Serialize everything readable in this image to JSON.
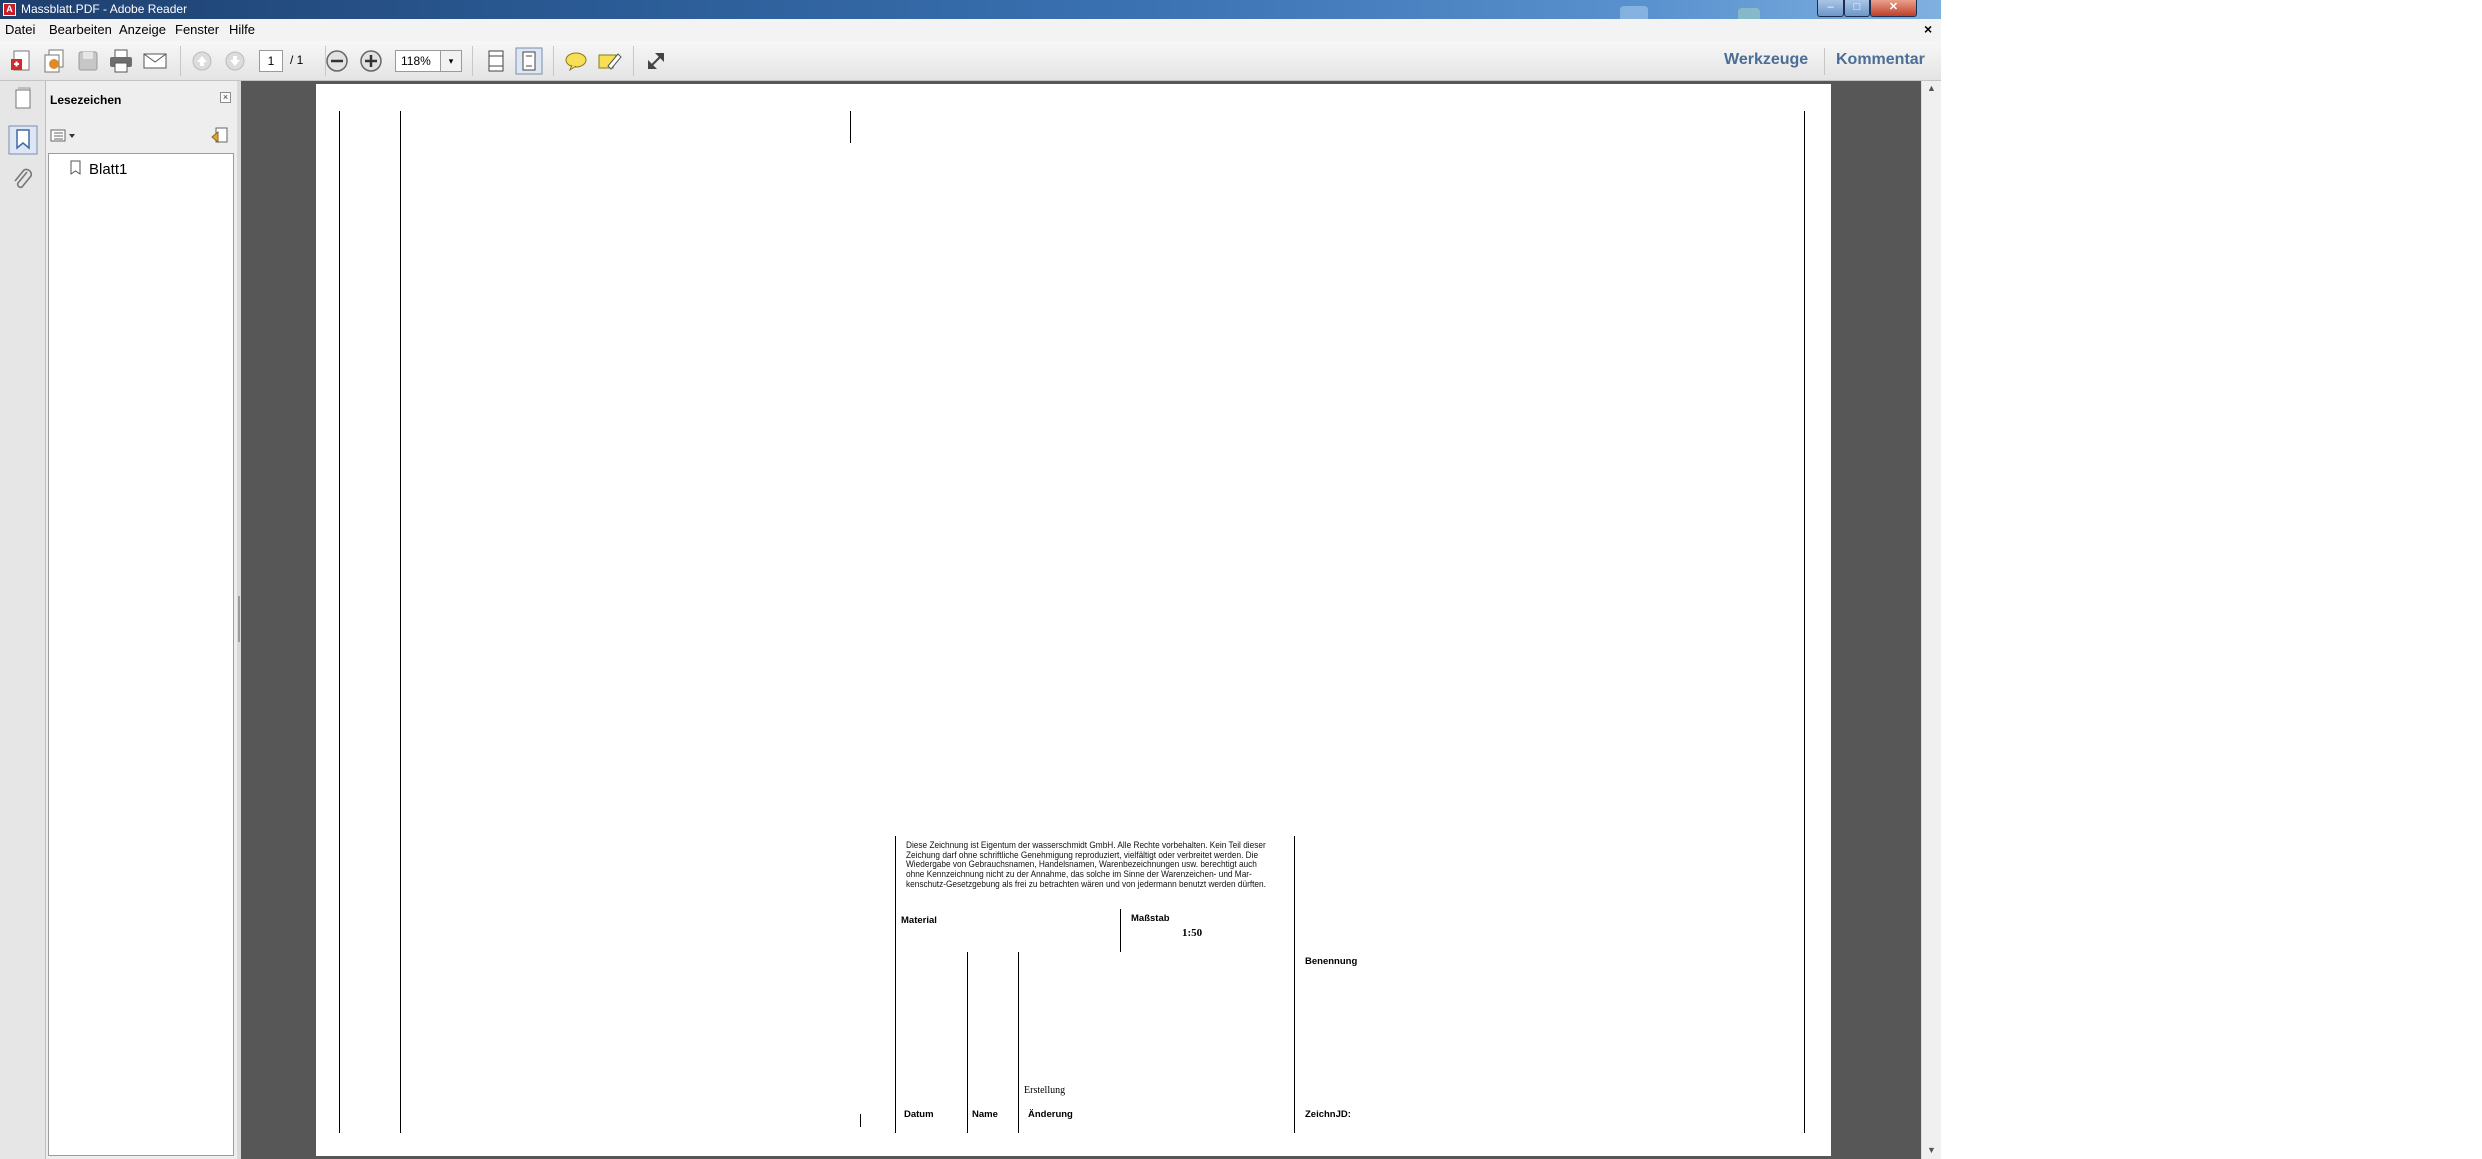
{
  "window": {
    "title": "Massblatt.PDF - Adobe Reader",
    "controls": {
      "minimize": "–",
      "maximize": "□",
      "close": "✕"
    }
  },
  "menubar": {
    "items": [
      "Datei",
      "Bearbeiten",
      "Anzeige",
      "Fenster",
      "Hilfe"
    ],
    "close_glyph": "×"
  },
  "toolbar": {
    "current_page": "1",
    "page_total": "/ 1",
    "zoom": "118%",
    "zoom_dropdown_glyph": "▾",
    "werkzeuge_label": "Werkzeuge",
    "kommentar_label": "Kommentar",
    "icons": [
      "create-pdf-icon",
      "combine-icon",
      "save-icon",
      "print-icon",
      "email-icon",
      "previous-page-icon",
      "next-page-icon",
      "zoom-out-icon",
      "zoom-in-icon",
      "fit-width-icon",
      "fit-page-icon",
      "comment-icon",
      "highlight-icon",
      "expand-icon"
    ]
  },
  "sidebar": {
    "panel_title": "Lesezeichen",
    "close_glyph": "×",
    "bookmarks": [
      {
        "label": "Blatt1"
      }
    ]
  },
  "document": {
    "copyright_lines": [
      "Diese Zeichnung ist Eigentum der wasserschmidt GmbH. Alle Rechte vorbehalten. Kein Teil dieser",
      "Zeichung darf ohne schriftliche  Genehmigung reproduziert, vielfältigt oder verbreitet werden. Die",
      "Wiedergabe von Gebrauchsnamen, Handelsnamen, Warenbezeichnungen usw. berechtigt auch",
      "ohne Kennzeichnung nicht zu der Annahme, das solche im Sinne der  Warenzeichen- und Mar-",
      "kenschutz-Gesetzgebung als frei zu betrachten wären und von jedermann benutzt werden dürften."
    ],
    "material_label": "Material",
    "massstab_label": "Maßstab",
    "massstab_value": "1:50",
    "benennung_label": "Benennung",
    "erstellung_label": "Erstellung",
    "datum_label": "Datum",
    "name_label": "Name",
    "aenderung_label": "Änderung",
    "zeichnr_label": "ZeichnJD:"
  }
}
